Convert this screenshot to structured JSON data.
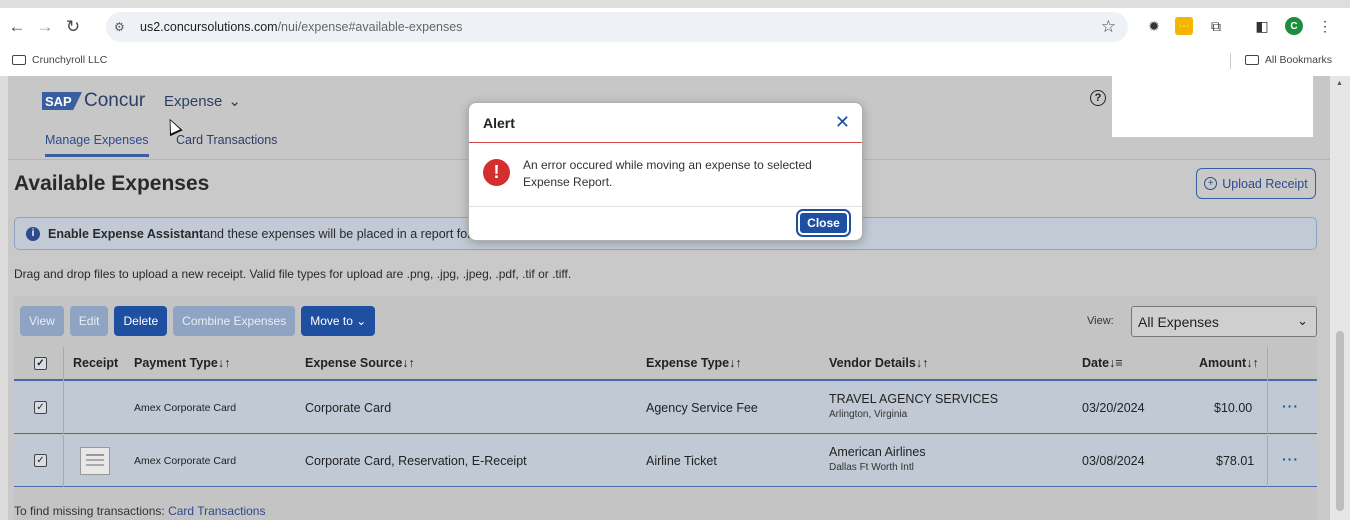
{
  "browser": {
    "url_host": "us2.concursolutions.com",
    "url_path": "/nui/expense#available-expenses",
    "profile_initial": "C",
    "bookmark_left": "Crunchyroll LLC",
    "bookmark_right": "All Bookmarks"
  },
  "header": {
    "logo_sap": "SAP",
    "logo_concur": "Concur",
    "menu_label": "Expense",
    "tabs": [
      {
        "label": "Manage Expenses",
        "active": true
      },
      {
        "label": "Card Transactions",
        "active": false
      }
    ]
  },
  "main": {
    "title": "Available Expenses",
    "upload_label": "Upload Receipt",
    "info_bold": "Enable Expense Assistant",
    "info_text": " and these expenses will be placed in a report for y",
    "drag_text": "Drag and drop files to upload a new receipt. Valid file types for upload are .png, .jpg, .jpeg, .pdf, .tif or .tiff.",
    "actions": {
      "view": "View",
      "edit": "Edit",
      "delete": "Delete",
      "combine": "Combine Expenses",
      "move_to": "Move to"
    },
    "view_label": "View:",
    "view_selected": "All Expenses",
    "columns": {
      "receipt": "Receipt",
      "payment_type": "Payment Type",
      "expense_source": "Expense Source",
      "expense_type": "Expense Type",
      "vendor": "Vendor Details",
      "date": "Date",
      "amount": "Amount"
    },
    "rows": [
      {
        "payment_type": "Amex Corporate Card",
        "expense_source": "Corporate Card",
        "expense_type": "Agency Service Fee",
        "vendor": "TRAVEL AGENCY SERVICES",
        "vendor_location": "Arlington, Virginia",
        "date": "03/20/2024",
        "amount": "$10.00"
      },
      {
        "payment_type": "Amex Corporate Card",
        "expense_source": "Corporate Card, Reservation, E-Receipt",
        "expense_type": "Airline Ticket",
        "vendor": "American Airlines",
        "vendor_location": "Dallas Ft Worth Intl",
        "date": "03/08/2024",
        "amount": "$78.01"
      }
    ],
    "missing_text": "To find missing transactions: ",
    "missing_link": "Card Transactions"
  },
  "modal": {
    "title": "Alert",
    "message": "An error occured while moving an expense to selected Expense Report.",
    "close_label": "Close"
  },
  "colors": {
    "primary": "#1f4fa0",
    "error": "#d32f2f"
  }
}
